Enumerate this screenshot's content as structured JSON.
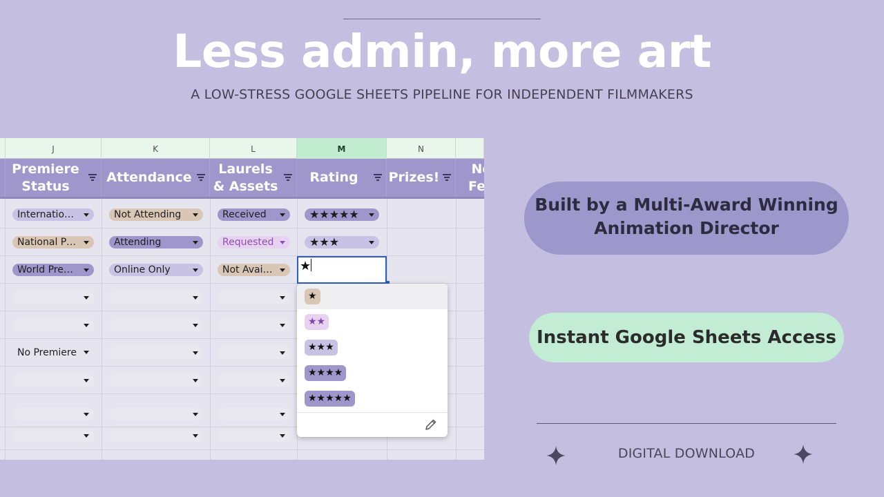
{
  "hero": {
    "title": "Less admin, more art",
    "subtitle": "A LOW-STRESS GOOGLE SHEETS PIPELINE FOR INDEPENDENT FILMMAKERS"
  },
  "sheet": {
    "columns": [
      "J",
      "K",
      "L",
      "M",
      "N"
    ],
    "selected_column": "M",
    "headers": {
      "premiere": [
        "Premiere",
        "Status"
      ],
      "attendance": "Attendance",
      "laurels": [
        "Laurels",
        "& Assets"
      ],
      "rating": "Rating",
      "prizes": "Prizes!",
      "notes": [
        "No",
        "Fee"
      ]
    },
    "rows": [
      {
        "premiere": "International Premiere",
        "attendance": "Not Attending",
        "laurels": "Received",
        "rating": "★★★★★"
      },
      {
        "premiere": "National Premiere",
        "attendance": "Attending",
        "laurels": "Requested",
        "rating": "★★★"
      },
      {
        "premiere": "World Premiere",
        "attendance": "Online Only",
        "laurels": "Not Available",
        "rating": ""
      },
      {
        "premiere": "",
        "attendance": "",
        "laurels": "",
        "rating": ""
      },
      {
        "premiere": "",
        "attendance": "",
        "laurels": "",
        "rating": ""
      },
      {
        "premiere": "No Premiere",
        "attendance": "",
        "laurels": "",
        "rating": ""
      },
      {
        "premiere": "",
        "attendance": "",
        "laurels": "",
        "rating": ""
      },
      {
        "premiere": "",
        "attendance": "",
        "laurels": "",
        "rating": ""
      },
      {
        "premiere": "",
        "attendance": "",
        "laurels": "",
        "rating": ""
      }
    ],
    "editing_value": "★",
    "dropdown_options": [
      "★",
      "★★",
      "★★★",
      "★★★★",
      "★★★★★"
    ]
  },
  "colors": {
    "background": "#c4bee0",
    "header": "#9f97cb",
    "chip_tan": "#d9c6b5",
    "chip_lavender": "#c8c2e4",
    "chip_purple": "#9f97cb",
    "chip_pink": "#e8d2f1",
    "selection_blue": "#2a5cc7",
    "mint": "#c2ecd3"
  },
  "badges": {
    "director": "Built by a Multi-Award Winning Animation Director",
    "access": "Instant Google Sheets Access",
    "download": "DIGITAL DOWNLOAD"
  },
  "icons": [
    "filter-icon",
    "dropdown-arrow-icon",
    "pencil-icon",
    "sparkle-icon"
  ]
}
